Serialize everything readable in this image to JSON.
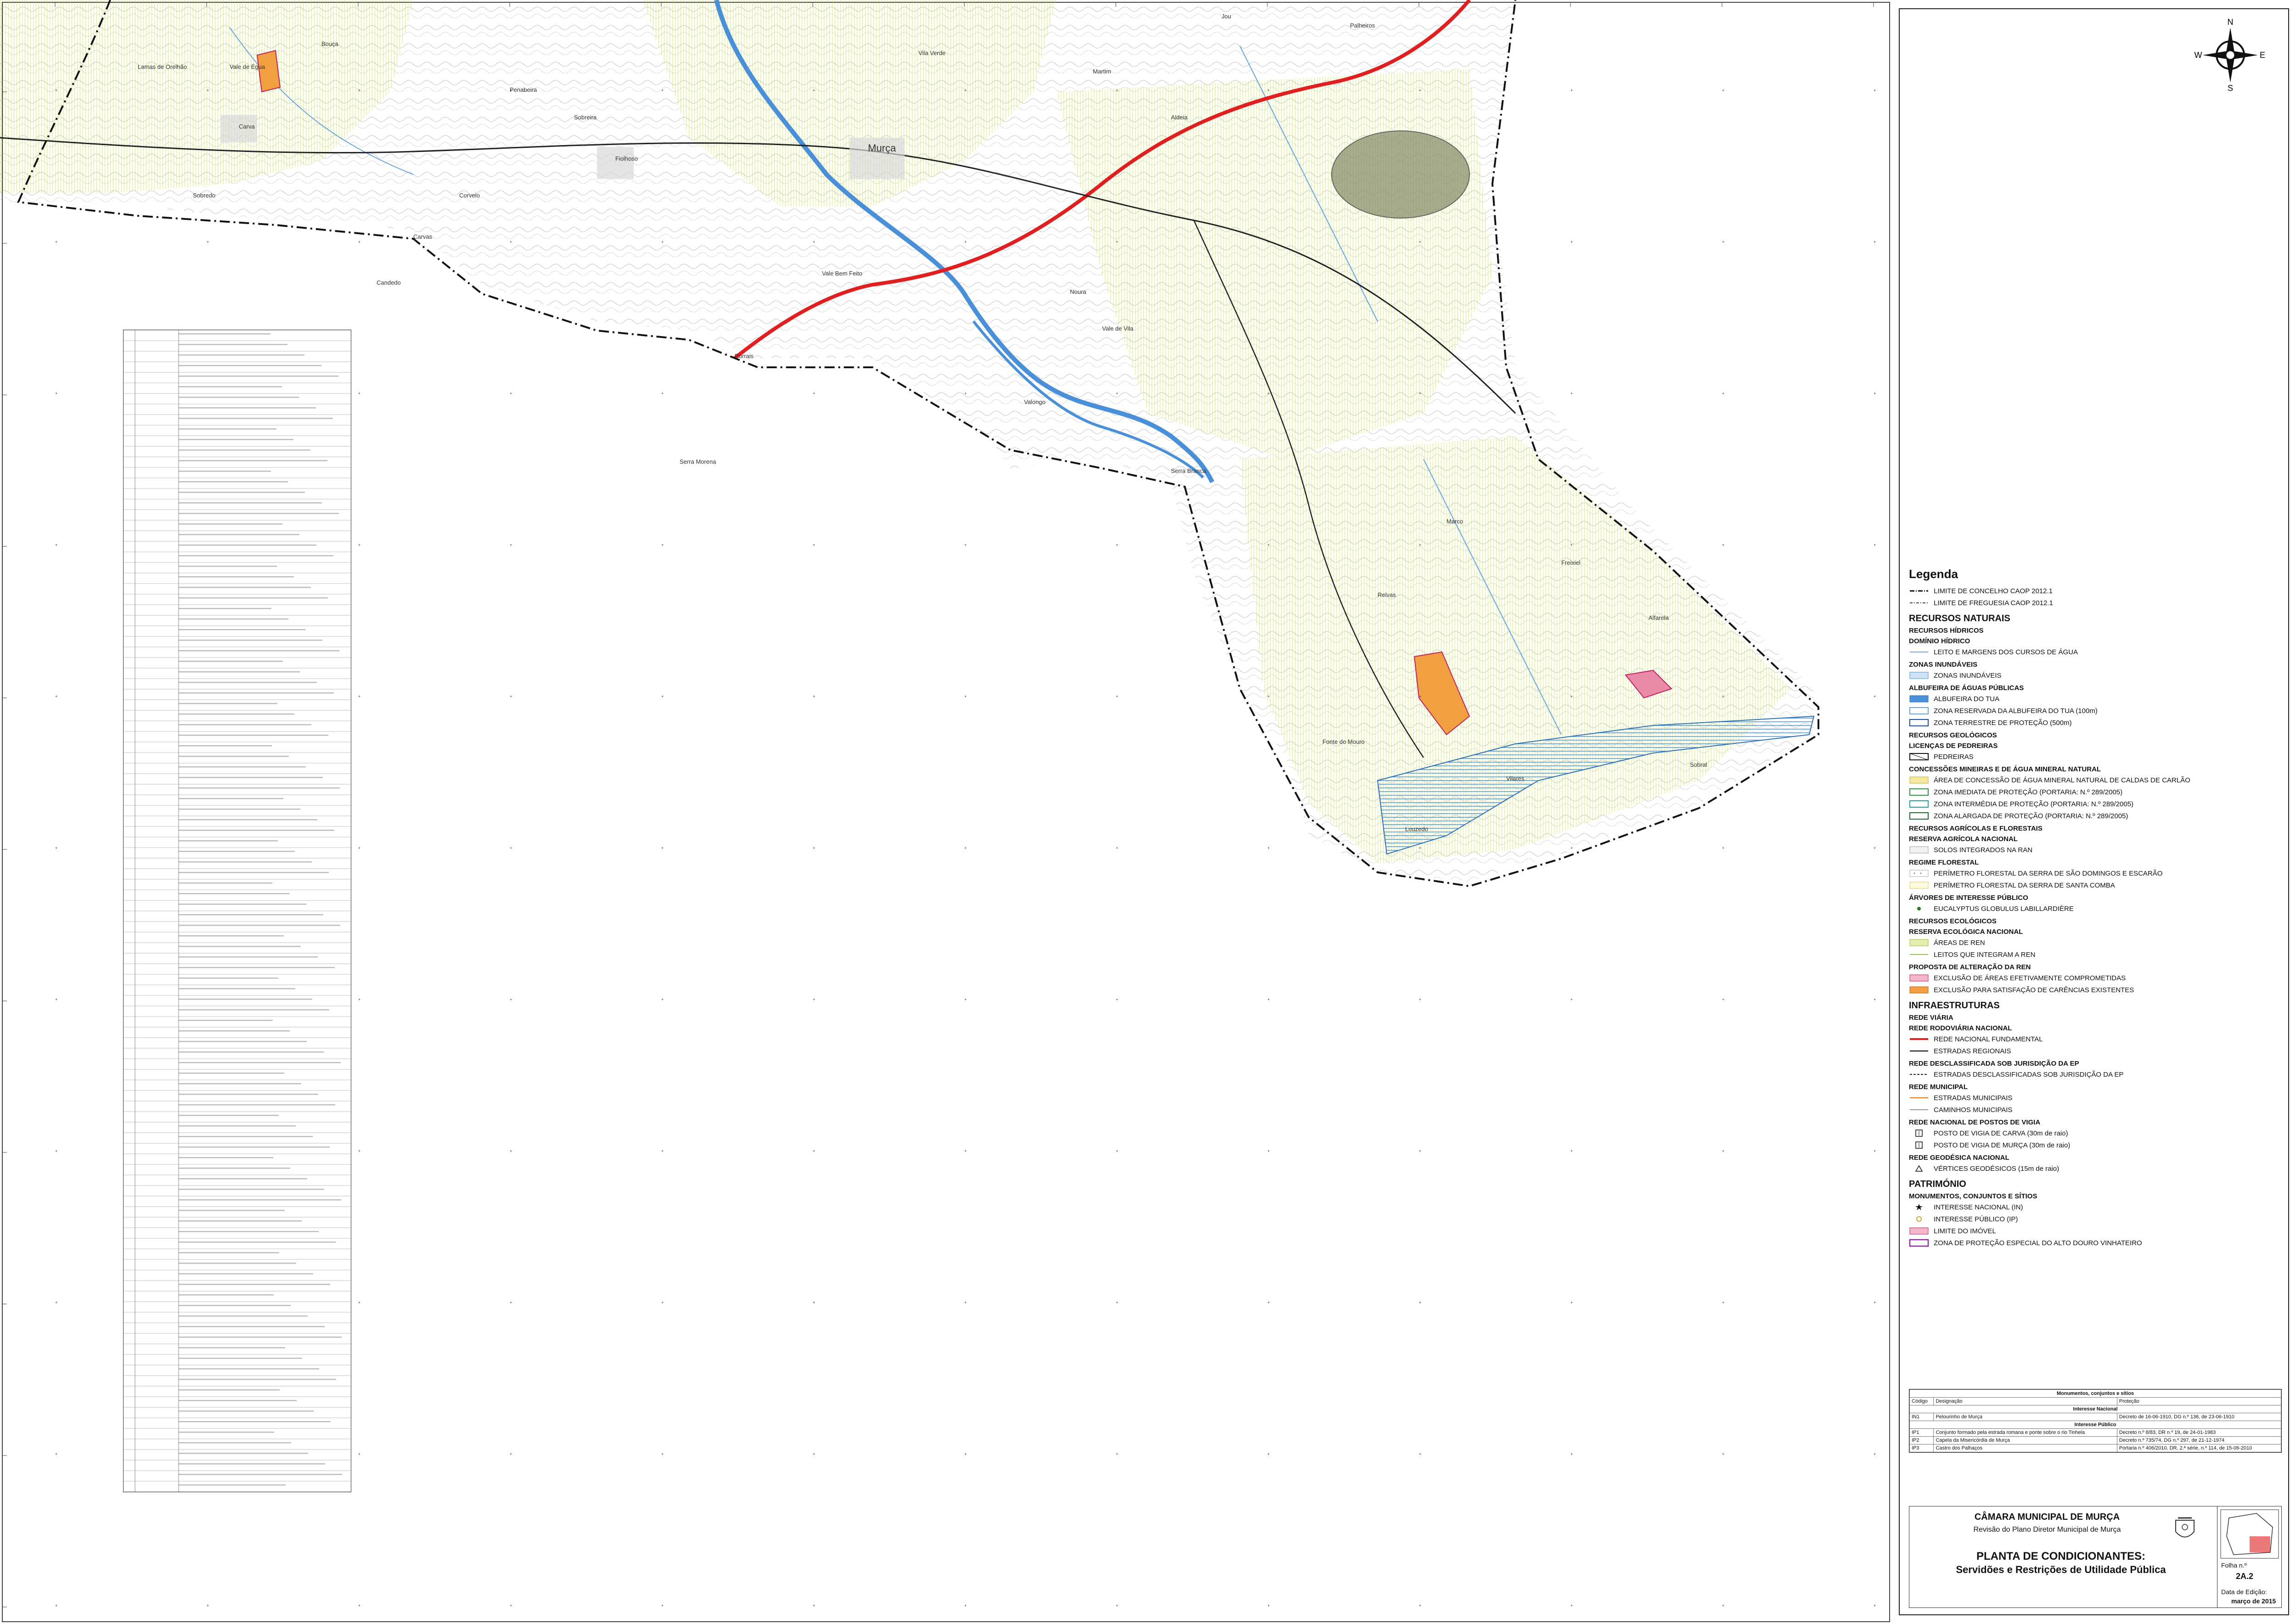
{
  "map": {
    "place_labels": [
      "Murça",
      "Fiolhoso",
      "Carva",
      "Jou",
      "Noura",
      "Sobreira",
      "Palheiros",
      "Candedo",
      "Vale de Égua",
      "Vale Bem Feito",
      "Martim",
      "Carvas",
      "Penabeira",
      "Porrais",
      "Serra Morena",
      "Serra Branca",
      "Fonte do Mouro",
      "Louzedo",
      "Alfarela",
      "Freixiel",
      "Sobral",
      "Lamas de Orelhão",
      "Vila Verde",
      "Aldeia",
      "Vale de Vila",
      "Valongo",
      "Corvelo",
      "Marco",
      "Relvas",
      "Sobredo",
      "Vilares",
      "Bouça"
    ],
    "colors": {
      "ren_hatch": "#cfe07a",
      "ran_line": "#8fbf4a",
      "river_blue": "#4a90d8",
      "contour": "#9a9a9a",
      "road_red": "#e02020",
      "road_black": "#222222",
      "orange_zone": "#f0a040",
      "pink_zone": "#e88aa8",
      "quarry": "#7a7f5a"
    }
  },
  "compass": {
    "n": "N",
    "s": "S",
    "e": "E",
    "w": "W"
  },
  "legend": {
    "title": "Legenda",
    "rows": [
      {
        "kind": "item",
        "label": "LIMITE DE CONCELHO CAOP 2012.1",
        "sym": "concelho"
      },
      {
        "kind": "item",
        "label": "LIMITE DE FREGUESIA CAOP 2012.1",
        "sym": "freguesia"
      },
      {
        "kind": "sec",
        "label": "RECURSOS NATURAIS"
      },
      {
        "kind": "sub",
        "label": "RECURSOS HÍDRICOS"
      },
      {
        "kind": "sub",
        "label": "DOMÍNIO HÍDRICO"
      },
      {
        "kind": "item",
        "label": "LEITO E MARGENS DOS CURSOS DE ÁGUA",
        "sym": "thinblue"
      },
      {
        "kind": "sub",
        "label": "ZONAS INUNDÁVEIS"
      },
      {
        "kind": "item",
        "label": "ZONAS INUNDÁVEIS",
        "sym": "hatchblue"
      },
      {
        "kind": "sub",
        "label": "ALBUFEIRA DE ÁGUAS PÚBLICAS"
      },
      {
        "kind": "item",
        "label": "ALBUFEIRA DO TUA",
        "sym": "fillblue"
      },
      {
        "kind": "item",
        "label": "ZONA RESERVADA DA ALBUFEIRA DO TUA (100m)",
        "sym": "boxblue"
      },
      {
        "kind": "item",
        "label": "ZONA TERRESTRE DE PROTEÇÃO (500m)",
        "sym": "boxdarkblue"
      },
      {
        "kind": "sub",
        "label": "RECURSOS GEOLÓGICOS"
      },
      {
        "kind": "sub",
        "label": "LICENÇAS DE PEDREIRAS"
      },
      {
        "kind": "item",
        "label": "PEDREIRAS",
        "sym": "quarry"
      },
      {
        "kind": "sub",
        "label": "CONCESSÕES MINEIRAS E DE ÁGUA MINERAL NATURAL"
      },
      {
        "kind": "item",
        "label": "ÁREA DE CONCESSÃO DE ÁGUA MINERAL NATURAL DE CALDAS DE CARLÃO",
        "sym": "hatchyellow"
      },
      {
        "kind": "item",
        "label": "ZONA IMEDIATA DE PROTEÇÃO (PORTARIA: N.º 289/2005)",
        "sym": "boxgreen"
      },
      {
        "kind": "item",
        "label": "ZONA INTERMÉDIA DE PROTEÇÃO (PORTARIA: N.º 289/2005)",
        "sym": "boxteal"
      },
      {
        "kind": "item",
        "label": "ZONA ALARGADA DE PROTEÇÃO (PORTARIA: N.º 289/2005)",
        "sym": "boxdarkgreen"
      },
      {
        "kind": "sub",
        "label": "RECURSOS AGRÍCOLAS E FLORESTAIS"
      },
      {
        "kind": "sub",
        "label": "RESERVA AGRÍCOLA NACIONAL"
      },
      {
        "kind": "item",
        "label": "SOLOS INTEGRADOS NA RAN",
        "sym": "boxgrey"
      },
      {
        "kind": "sub",
        "label": "REGIME FLORESTAL"
      },
      {
        "kind": "item",
        "label": "PERÍMETRO FLORESTAL DA SERRA DE SÃO DOMINGOS E ESCARÃO",
        "sym": "dotsgrey"
      },
      {
        "kind": "item",
        "label": "PERÍMETRO FLORESTAL DA SERRA DE SANTA COMBA",
        "sym": "dotsyellow"
      },
      {
        "kind": "sub",
        "label": "ÁRVORES DE INTERESSE PÚBLICO"
      },
      {
        "kind": "item",
        "label": "EUCALYPTUS GLOBULUS LABILLARDIÈRE",
        "sym": "tree"
      },
      {
        "kind": "sub",
        "label": "RECURSOS ECOLÓGICOS"
      },
      {
        "kind": "sub",
        "label": "RESERVA ECOLÓGICA NACIONAL"
      },
      {
        "kind": "item",
        "label": "ÁREAS DE REN",
        "sym": "hatchgreen"
      },
      {
        "kind": "item",
        "label": "LEITOS QUE INTEGRAM A REN",
        "sym": "thingreen"
      },
      {
        "kind": "sub",
        "label": "PROPOSTA DE ALTERAÇÃO DA REN"
      },
      {
        "kind": "item",
        "label": "EXCLUSÃO DE ÁREAS EFETIVAMENTE COMPROMETIDAS",
        "sym": "fillpink"
      },
      {
        "kind": "item",
        "label": "EXCLUSÃO PARA SATISFAÇÃO DE CARÊNCIAS EXISTENTES",
        "sym": "fillorange"
      },
      {
        "kind": "sec",
        "label": "INFRAESTRUTURAS"
      },
      {
        "kind": "sub",
        "label": "REDE VIÁRIA"
      },
      {
        "kind": "sub",
        "label": "REDE RODOVIÁRIA NACIONAL"
      },
      {
        "kind": "item",
        "label": "REDE NACIONAL FUNDAMENTAL",
        "sym": "linered"
      },
      {
        "kind": "item",
        "label": "ESTRADAS REGIONAIS",
        "sym": "lineblack"
      },
      {
        "kind": "sub",
        "label": "REDE DESCLASSIFICADA SOB JURISDIÇÃO DA EP"
      },
      {
        "kind": "item",
        "label": "ESTRADAS DESCLASSIFICADAS SOB JURISDIÇÃO DA EP",
        "sym": "linedash"
      },
      {
        "kind": "sub",
        "label": "REDE MUNICIPAL"
      },
      {
        "kind": "item",
        "label": "ESTRADAS MUNICIPAIS",
        "sym": "lineorange"
      },
      {
        "kind": "item",
        "label": "CAMINHOS MUNICIPAIS",
        "sym": "linegrey"
      },
      {
        "kind": "sub",
        "label": "REDE NACIONAL DE POSTOS DE VIGIA"
      },
      {
        "kind": "item",
        "label": "POSTO DE VIGIA DE CARVA (30m de raio)",
        "sym": "vigia"
      },
      {
        "kind": "item",
        "label": "POSTO DE VIGIA DE MURÇA (30m de raio)",
        "sym": "vigia"
      },
      {
        "kind": "sub",
        "label": "REDE GEODÉSICA NACIONAL"
      },
      {
        "kind": "item",
        "label": "VÉRTICES GEODÉSICOS (15m de raio)",
        "sym": "vertice"
      },
      {
        "kind": "sec",
        "label": "PATRIMÓNIO"
      },
      {
        "kind": "sub",
        "label": "MONUMENTOS, CONJUNTOS E SÍTIOS"
      },
      {
        "kind": "item",
        "label": "INTERESSE NACIONAL (IN)",
        "sym": "star"
      },
      {
        "kind": "item",
        "label": "INTERESSE PÚBLICO (IP)",
        "sym": "circle"
      },
      {
        "kind": "item",
        "label": "LIMITE DO IMÓVEL",
        "sym": "fillpink"
      },
      {
        "kind": "item",
        "label": "ZONA DE PROTEÇÃO ESPECIAL DO ALTO DOURO VINHATEIRO",
        "sym": "boxpurple"
      }
    ]
  },
  "monuments": {
    "title": "Monumentos, conjuntos e sítios",
    "headers": [
      "Código",
      "Designação",
      "Proteção"
    ],
    "groups": [
      {
        "heading": "Interesse Nacional",
        "rows": [
          [
            "IN1",
            "Pelourinho de Murça",
            "Decreto de 16-06-1910, DG n.º 136, de 23-06-1910"
          ]
        ]
      },
      {
        "heading": "Interesse Público",
        "rows": [
          [
            "IP1",
            "Conjunto formado pela estrada romana e ponte sobre o rio Tinhela",
            "Decreto n.º 8/83, DR n.º 19, de 24-01-1983"
          ],
          [
            "IP2",
            "Capela da Misericórdia de Murça",
            "Decreto n.º 735/74, DG n.º 297, de 21-12-1974"
          ],
          [
            "IP3",
            "Castro dos Palhaços",
            "Portaria n.º 406/2010, DR, 2.ª série, n.º 114, de 15-06-2010"
          ]
        ]
      }
    ]
  },
  "title_block": {
    "camara": "CÂMARA MUNICIPAL DE MURÇA",
    "revisao": "Revisão do Plano Diretor Municipal de Murça",
    "planta": "PLANTA DE CONDICIONANTES:",
    "subtitulo": "Servidões e Restrições de Utilidade Pública",
    "folha_label": "Folha n.º",
    "folha": "2A.2",
    "data_label": "Data de Edição:",
    "data": "março de 2015"
  }
}
